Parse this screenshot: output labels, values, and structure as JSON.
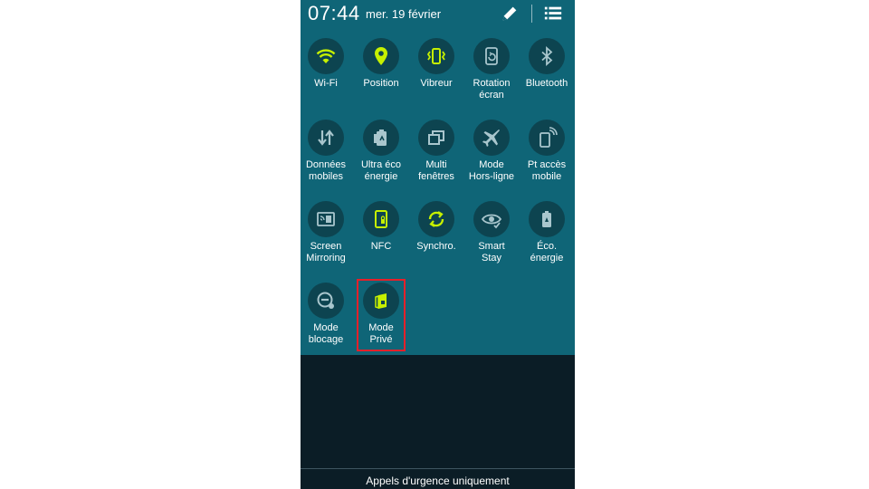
{
  "status_bar": {
    "time": "07:44",
    "date": "mer. 19 février",
    "icons": [
      "edit-pencil-icon",
      "list-menu-icon"
    ]
  },
  "colors": {
    "panel_bg": "#0f6577",
    "tile_bg": "#0d4450",
    "active_icon": "#c6f000",
    "inactive_icon": "#a9c6cd",
    "lower_bg": "#0b1d26",
    "highlight_border": "#e5202a"
  },
  "quick_settings": {
    "rows": [
      [
        {
          "label": "Wi-Fi",
          "icon": "wifi-icon",
          "active": true
        },
        {
          "label": "Position",
          "icon": "location-pin-icon",
          "active": true
        },
        {
          "label": "Vibreur",
          "icon": "vibrate-icon",
          "active": true
        },
        {
          "label": "Rotation\nécran",
          "icon": "rotation-icon",
          "active": false
        },
        {
          "label": "Bluetooth",
          "icon": "bluetooth-icon",
          "active": false
        }
      ],
      [
        {
          "label": "Données\nmobiles",
          "icon": "mobile-data-icon",
          "active": false
        },
        {
          "label": "Ultra éco\nénergie",
          "icon": "ultra-power-saving-icon",
          "active": false
        },
        {
          "label": "Multi\nfenêtres",
          "icon": "multi-window-icon",
          "active": false
        },
        {
          "label": "Mode\nHors-ligne",
          "icon": "airplane-icon",
          "active": false
        },
        {
          "label": "Pt accès\nmobile",
          "icon": "hotspot-icon",
          "active": false
        }
      ],
      [
        {
          "label": "Screen\nMirroring",
          "icon": "screen-mirroring-icon",
          "active": false
        },
        {
          "label": "NFC",
          "icon": "nfc-icon",
          "active": true
        },
        {
          "label": "Synchro.",
          "icon": "sync-icon",
          "active": true
        },
        {
          "label": "Smart\nStay",
          "icon": "smart-stay-icon",
          "active": false
        },
        {
          "label": "Éco.\nénergie",
          "icon": "power-saving-icon",
          "active": false
        }
      ],
      [
        {
          "label": "Mode\nblocage",
          "icon": "blocking-mode-icon",
          "active": false
        },
        {
          "label": "Mode\nPrivé",
          "icon": "private-mode-icon",
          "active": true,
          "highlighted": true
        }
      ]
    ]
  },
  "footer": {
    "emergency_text": "Appels d'urgence uniquement"
  }
}
